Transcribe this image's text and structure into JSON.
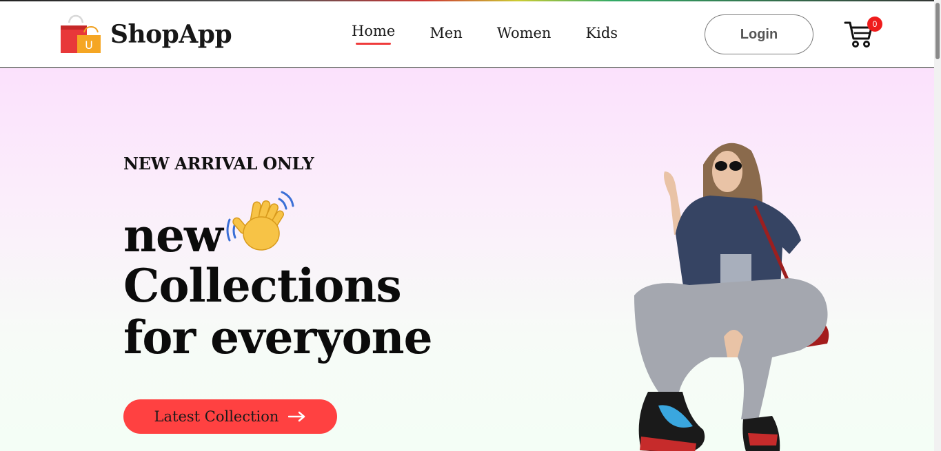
{
  "brand": {
    "name": "ShopApp",
    "logo_icon": "shopping-bags-icon",
    "logo_letter": "U"
  },
  "nav": {
    "items": [
      {
        "label": "Home",
        "active": true
      },
      {
        "label": "Men",
        "active": false
      },
      {
        "label": "Women",
        "active": false
      },
      {
        "label": "Kids",
        "active": false
      }
    ]
  },
  "header": {
    "login_label": "Login",
    "cart_icon": "shopping-cart-icon",
    "cart_count": "0"
  },
  "hero": {
    "eyebrow": "NEW ARRIVAL ONLY",
    "line1": "new",
    "wave_icon": "waving-hand-icon",
    "line2": "Collections",
    "line3": "for everyone",
    "cta_label": "Latest Collection",
    "cta_icon": "arrow-right-icon",
    "image": "hero-model-image"
  },
  "colors": {
    "accent": "#ff4141",
    "badge": "#ef1c1c",
    "hero_gradient_top": "#fbe1fc",
    "hero_gradient_bottom": "#f4fef6"
  }
}
